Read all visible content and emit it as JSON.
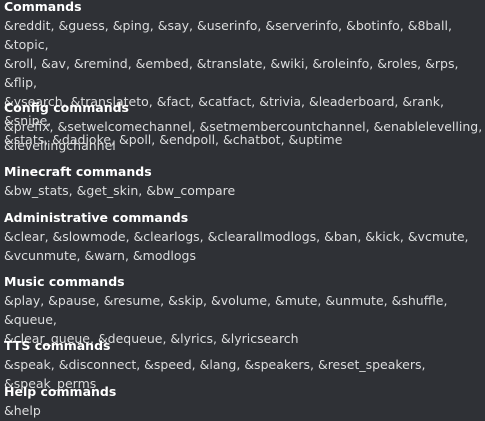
{
  "embed": {
    "fields": [
      {
        "name": "Commands",
        "lines": [
          "&reddit, &guess, &ping, &say, &userinfo, &serverinfo, &botinfo, &8ball, &topic,",
          "&roll, &av, &remind, &embed, &translate, &wiki, &roleinfo, &roles, &rps, &flip,",
          "&ysearch, &translateto, &fact, &catfact, &trivia, &leaderboard, &rank, &snipe,",
          "&stats, &dadjoke, &poll, &endpoll, &chatbot, &uptime"
        ]
      },
      {
        "name": "Config commands",
        "lines": [
          "&prefix, &setwelcomechannel, &setmembercountchannel, &enablelevelling,",
          "&levellingchannel"
        ]
      },
      {
        "name": "Minecraft commands",
        "lines": [
          "&bw_stats, &get_skin, &bw_compare"
        ]
      },
      {
        "name": "Administrative commands",
        "lines": [
          "&clear, &slowmode, &clearlogs, &clearallmodlogs, &ban, &kick, &vcmute,",
          "&vcunmute, &warn, &modlogs"
        ]
      },
      {
        "name": "Music commands",
        "lines": [
          "&play, &pause, &resume, &skip, &volume, &mute, &unmute, &shuffle, &queue,",
          "&clear_queue, &dequeue, &lyrics, &lyricsearch"
        ]
      },
      {
        "name": "TTS commands",
        "lines": [
          "&speak, &disconnect, &speed, &lang, &speakers, &reset_speakers, &speak_perms"
        ]
      },
      {
        "name": "Help commands",
        "lines": [
          "&help"
        ]
      }
    ]
  }
}
